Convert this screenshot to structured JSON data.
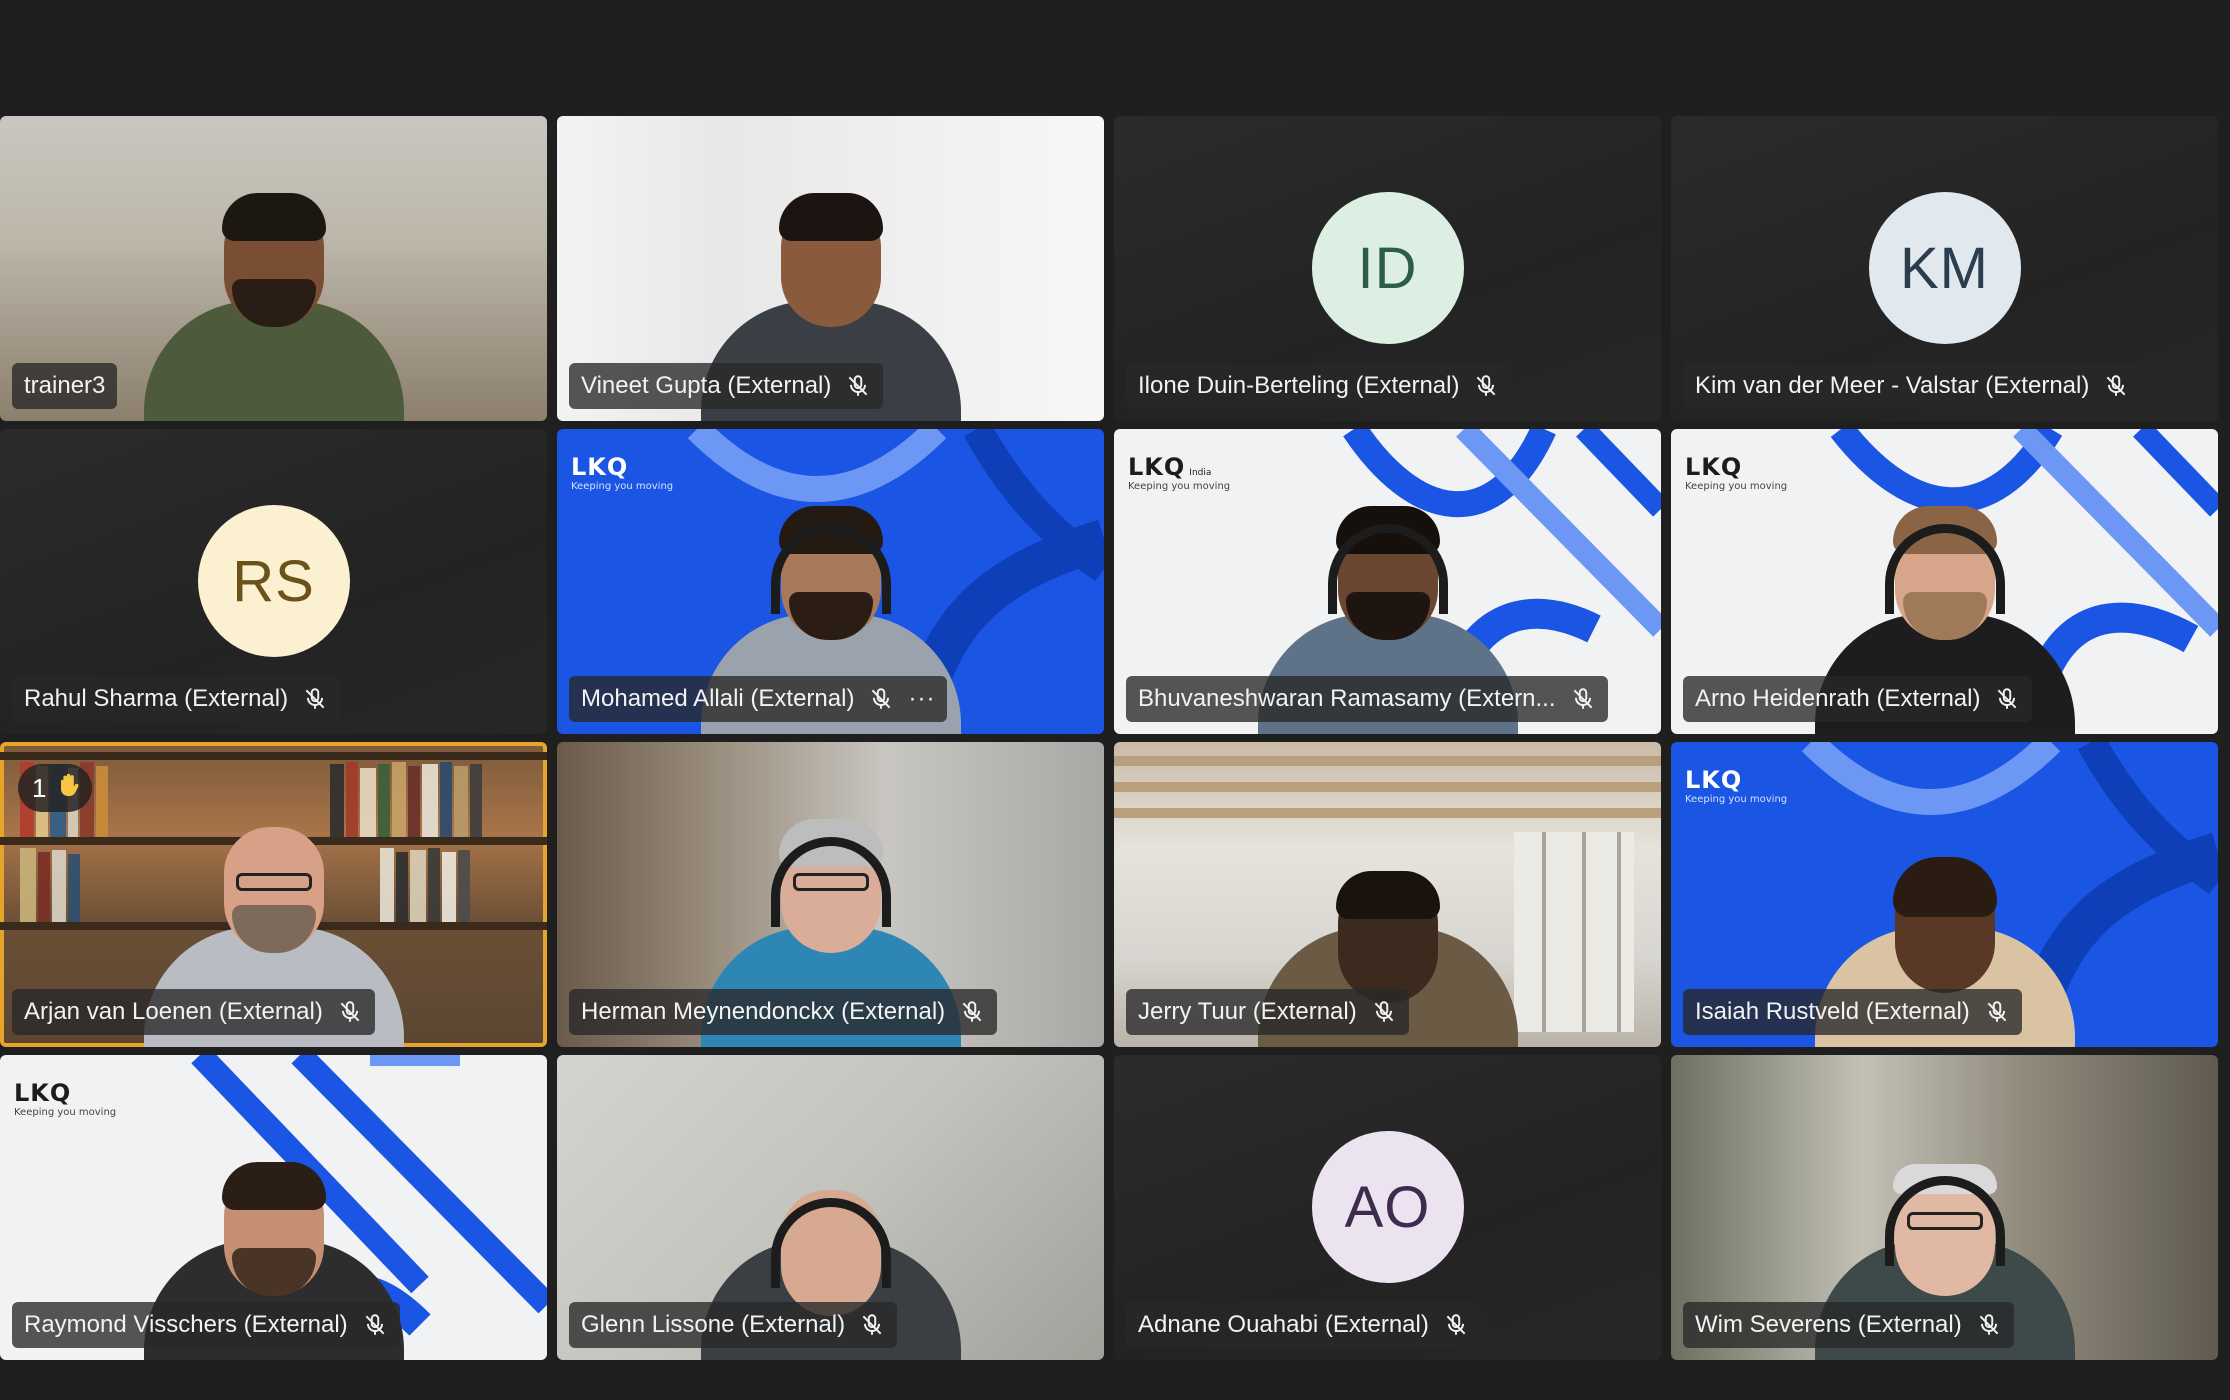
{
  "participants": [
    {
      "name": "trainer3",
      "muted": false,
      "kind": "video"
    },
    {
      "name": "Vineet Gupta (External)",
      "muted": true,
      "kind": "video"
    },
    {
      "name": "Ilone Duin-Berteling (External)",
      "muted": true,
      "kind": "avatar",
      "initials": "ID",
      "avatar_bg": "#dcefe2",
      "avatar_fg": "#2e5d47"
    },
    {
      "name": "Kim van der Meer - Valstar (External)",
      "muted": true,
      "kind": "avatar",
      "initials": "KM",
      "avatar_bg": "#e1e9ef",
      "avatar_fg": "#2c3d4e"
    },
    {
      "name": "Rahul Sharma (External)",
      "muted": true,
      "kind": "avatar",
      "initials": "RS",
      "avatar_bg": "#fbf0cf",
      "avatar_fg": "#6b521a"
    },
    {
      "name": "Mohamed Allali (External)",
      "muted": true,
      "kind": "video",
      "more_label": "···"
    },
    {
      "name": "Bhuvaneshwaran Ramasamy (Extern...",
      "muted": true,
      "kind": "video"
    },
    {
      "name": "Arno Heidenrath (External)",
      "muted": true,
      "kind": "video"
    },
    {
      "name": "Arjan van Loenen (External)",
      "muted": true,
      "kind": "video",
      "raised_hand_count": "1",
      "active_speaker": true
    },
    {
      "name": "Herman Meynendonckx (External)",
      "muted": true,
      "kind": "video"
    },
    {
      "name": "Jerry Tuur (External)",
      "muted": true,
      "kind": "video"
    },
    {
      "name": "Isaiah Rustveld (External)",
      "muted": true,
      "kind": "video"
    },
    {
      "name": "Raymond Visschers (External)",
      "muted": true,
      "kind": "video"
    },
    {
      "name": "Glenn Lissone (External)",
      "muted": true,
      "kind": "video"
    },
    {
      "name": "Adnane Ouahabi (External)",
      "muted": true,
      "kind": "avatar",
      "initials": "AO",
      "avatar_bg": "#ece3f1",
      "avatar_fg": "#3f2b4d"
    },
    {
      "name": "Wim Severens (External)",
      "muted": true,
      "kind": "video"
    }
  ],
  "branding": {
    "logo": "LKQ",
    "tagline": "Keeping you moving",
    "india": "India"
  },
  "colors": {
    "background": "#1f1f1f",
    "active_border": "#e6a42b",
    "lkq_blue": "#1a55e3"
  }
}
